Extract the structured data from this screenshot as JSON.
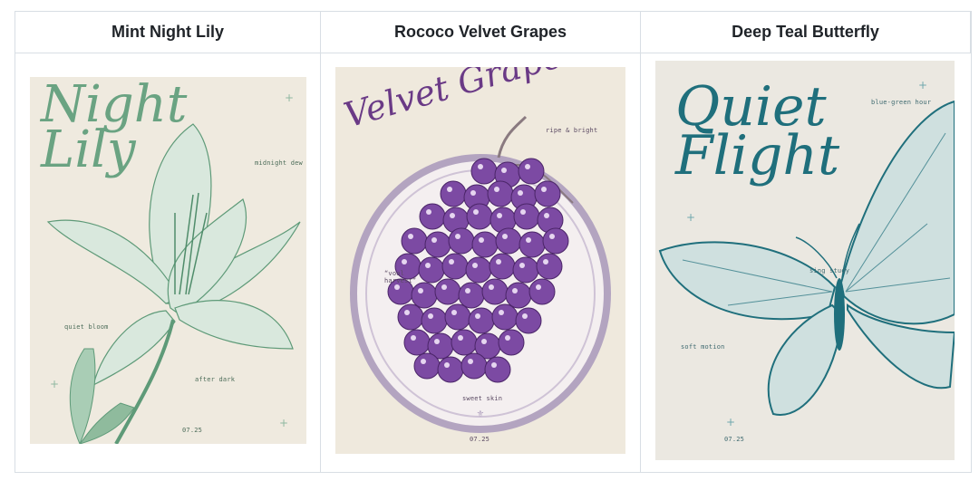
{
  "columns": [
    {
      "header": "Mint Night Lily",
      "poster": {
        "title": "Night\nLily",
        "notes": {
          "top": "midnight dew",
          "left": "quiet bloom",
          "bottom": "after dark",
          "date": "07.25"
        },
        "colors": {
          "bg": "#efeadf",
          "ink": "#5e9a78",
          "inkLight": "#a9cdb5"
        }
      }
    },
    {
      "header": "Rococo Velvet Grapes",
      "poster": {
        "title": "Velvet Grapes",
        "notes": {
          "top": "ripe & bright",
          "left": "“vool\nharvest”",
          "bottom": "sweet skin",
          "date": "07.25"
        },
        "colors": {
          "bg": "#efe9dd",
          "ink": "#6a3a86",
          "grape": "#7c4aa3",
          "frame": "#b3a4c0"
        }
      }
    },
    {
      "header": "Deep Teal Butterfly",
      "poster": {
        "title": "Quiet\nFlight",
        "notes": {
          "top": "blue-green hour",
          "left": "soft motion",
          "mid": "sing study",
          "date": "07.25"
        },
        "colors": {
          "bg": "#ebe8e1",
          "ink": "#1f6f7c",
          "inkLight": "#6fa7ad"
        }
      }
    }
  ]
}
